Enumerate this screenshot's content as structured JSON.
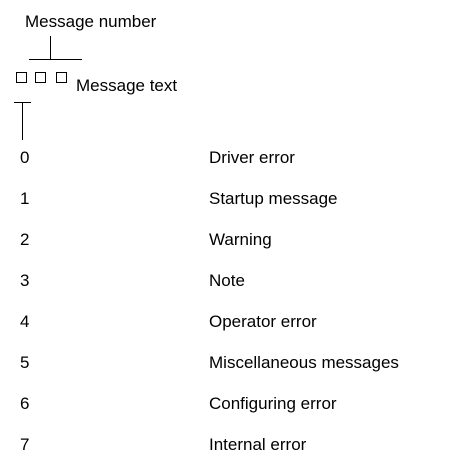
{
  "header": {
    "message_number_label": "Message number",
    "message_text_label": "Message text"
  },
  "codes": [
    {
      "digit": "0",
      "description": "Driver error"
    },
    {
      "digit": "1",
      "description": "Startup message"
    },
    {
      "digit": "2",
      "description": "Warning"
    },
    {
      "digit": "3",
      "description": "Note"
    },
    {
      "digit": "4",
      "description": "Operator error"
    },
    {
      "digit": "5",
      "description": "Miscellaneous messages"
    },
    {
      "digit": "6",
      "description": "Configuring error"
    },
    {
      "digit": "7",
      "description": "Internal error"
    }
  ]
}
